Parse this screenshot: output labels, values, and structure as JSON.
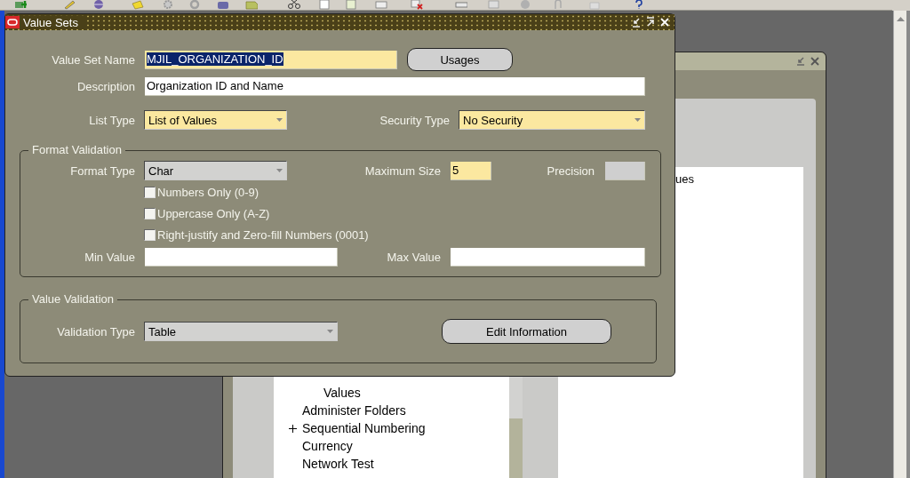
{
  "navigator_window": {
    "tree": [
      {
        "kind": "group",
        "children": [
          {
            "kind": "leaf",
            "label": "Values"
          }
        ]
      },
      {
        "kind": "leaf",
        "label": "Administer Folders"
      },
      {
        "kind": "branch",
        "label": "Sequential Numbering",
        "expanded": false
      },
      {
        "kind": "leaf",
        "label": "Currency"
      },
      {
        "kind": "leaf",
        "label": "Network Test"
      }
    ],
    "panel_text": "ues"
  },
  "dialog": {
    "title": "Value Sets",
    "value_set_name": {
      "label": "Value Set Name",
      "value": "MJIL_ORGANIZATION_ID",
      "required": true,
      "selected": true
    },
    "usages_button": "Usages",
    "description": {
      "label": "Description",
      "value": "Organization ID and Name",
      "required": false
    },
    "list_type": {
      "label": "List Type",
      "value": "List of Values",
      "required": true
    },
    "security_type": {
      "label": "Security Type",
      "value": "No Security",
      "required": true
    },
    "format_validation": {
      "title": "Format Validation",
      "format_type": {
        "label": "Format Type",
        "value": "Char",
        "required": false
      },
      "maximum_size": {
        "label": "Maximum Size",
        "value": "5",
        "required": true
      },
      "precision": {
        "label": "Precision",
        "disabled": true
      },
      "options": [
        {
          "label": "Numbers Only (0-9)",
          "checked": false
        },
        {
          "label": "Uppercase Only (A-Z)",
          "checked": false
        },
        {
          "label": "Right-justify and Zero-fill Numbers (0001)",
          "checked": false
        }
      ],
      "min_value": {
        "label": "Min Value",
        "required": false
      },
      "max_value": {
        "label": "Max Value",
        "required": false
      }
    },
    "value_validation": {
      "title": "Value Validation",
      "validation_type": {
        "label": "Validation Type",
        "value": "Table",
        "required": false
      },
      "edit_button": "Edit Information"
    }
  }
}
